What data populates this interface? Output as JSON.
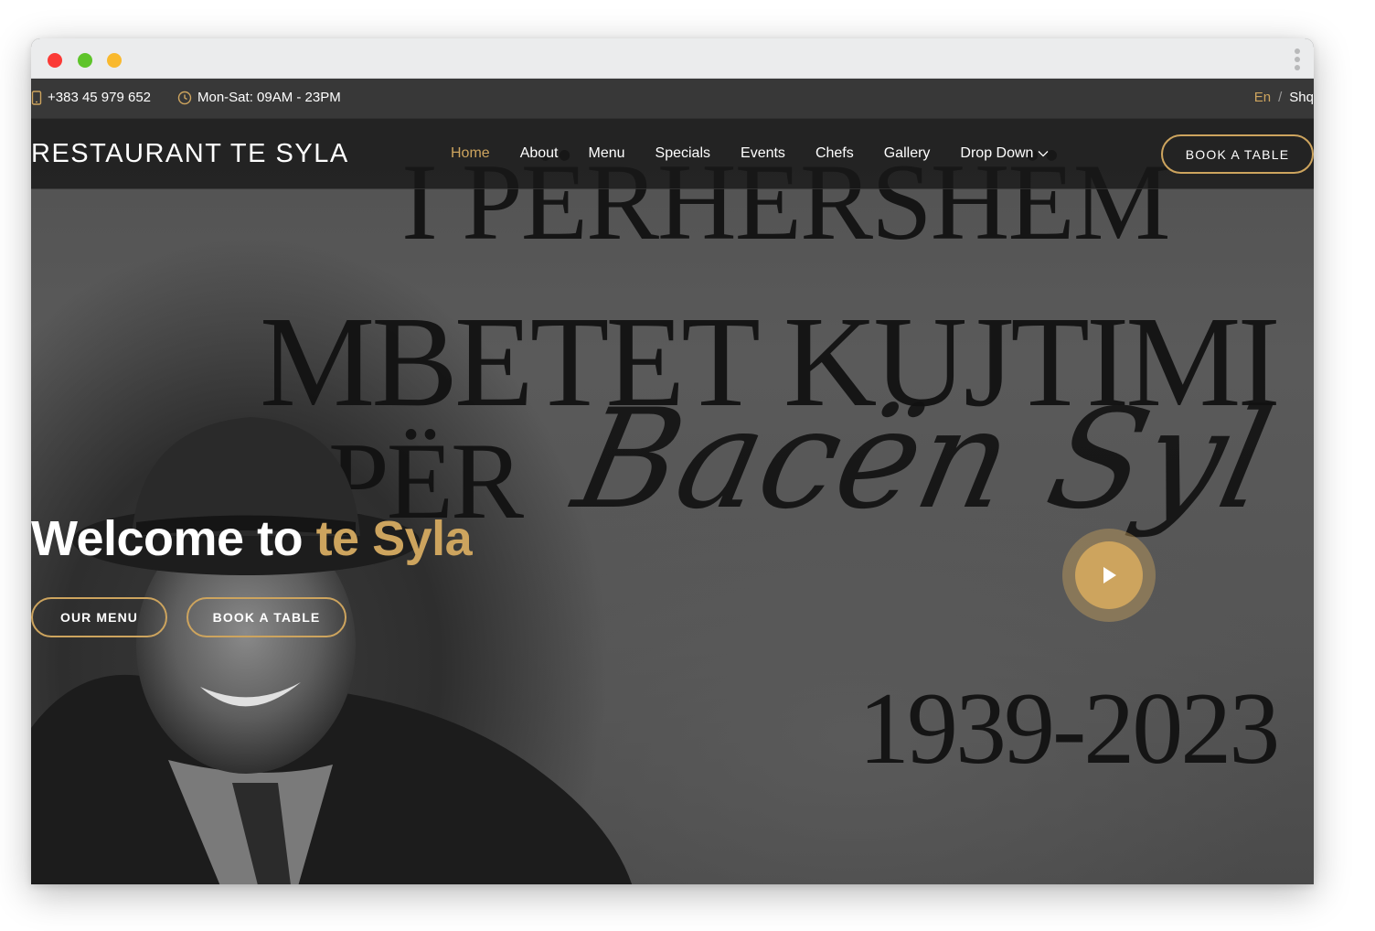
{
  "topbar": {
    "phone": "+383 45 979 652",
    "hours": "Mon-Sat: 09AM - 23PM",
    "lang_active": "En",
    "lang_separator": "/",
    "lang_other": "Shq"
  },
  "navbar": {
    "logo": "RESTAURANT TE SYLA",
    "items": [
      {
        "label": "Home",
        "active": true
      },
      {
        "label": "About"
      },
      {
        "label": "Menu"
      },
      {
        "label": "Specials"
      },
      {
        "label": "Events"
      },
      {
        "label": "Chefs"
      },
      {
        "label": "Gallery"
      },
      {
        "label": "Drop Down",
        "icon": "chevron-down-icon"
      }
    ],
    "cta": "BOOK A TABLE"
  },
  "hero": {
    "title_plain": "Welcome to",
    "title_accent": "te Syla",
    "btn_menu": "OUR MENU",
    "btn_book": "BOOK A TABLE",
    "play_icon": "play-icon",
    "background_text": {
      "line1": "I PËRHERSHËM",
      "line2": "MBETET KUJTIMI",
      "line3": "PËR",
      "script": "Bacën Syl",
      "years": "1939-2023"
    }
  },
  "colors": {
    "accent": "#cda45e",
    "text": "#ffffff",
    "topbar_bg": "#373737",
    "navbar_bg": "#181818"
  }
}
